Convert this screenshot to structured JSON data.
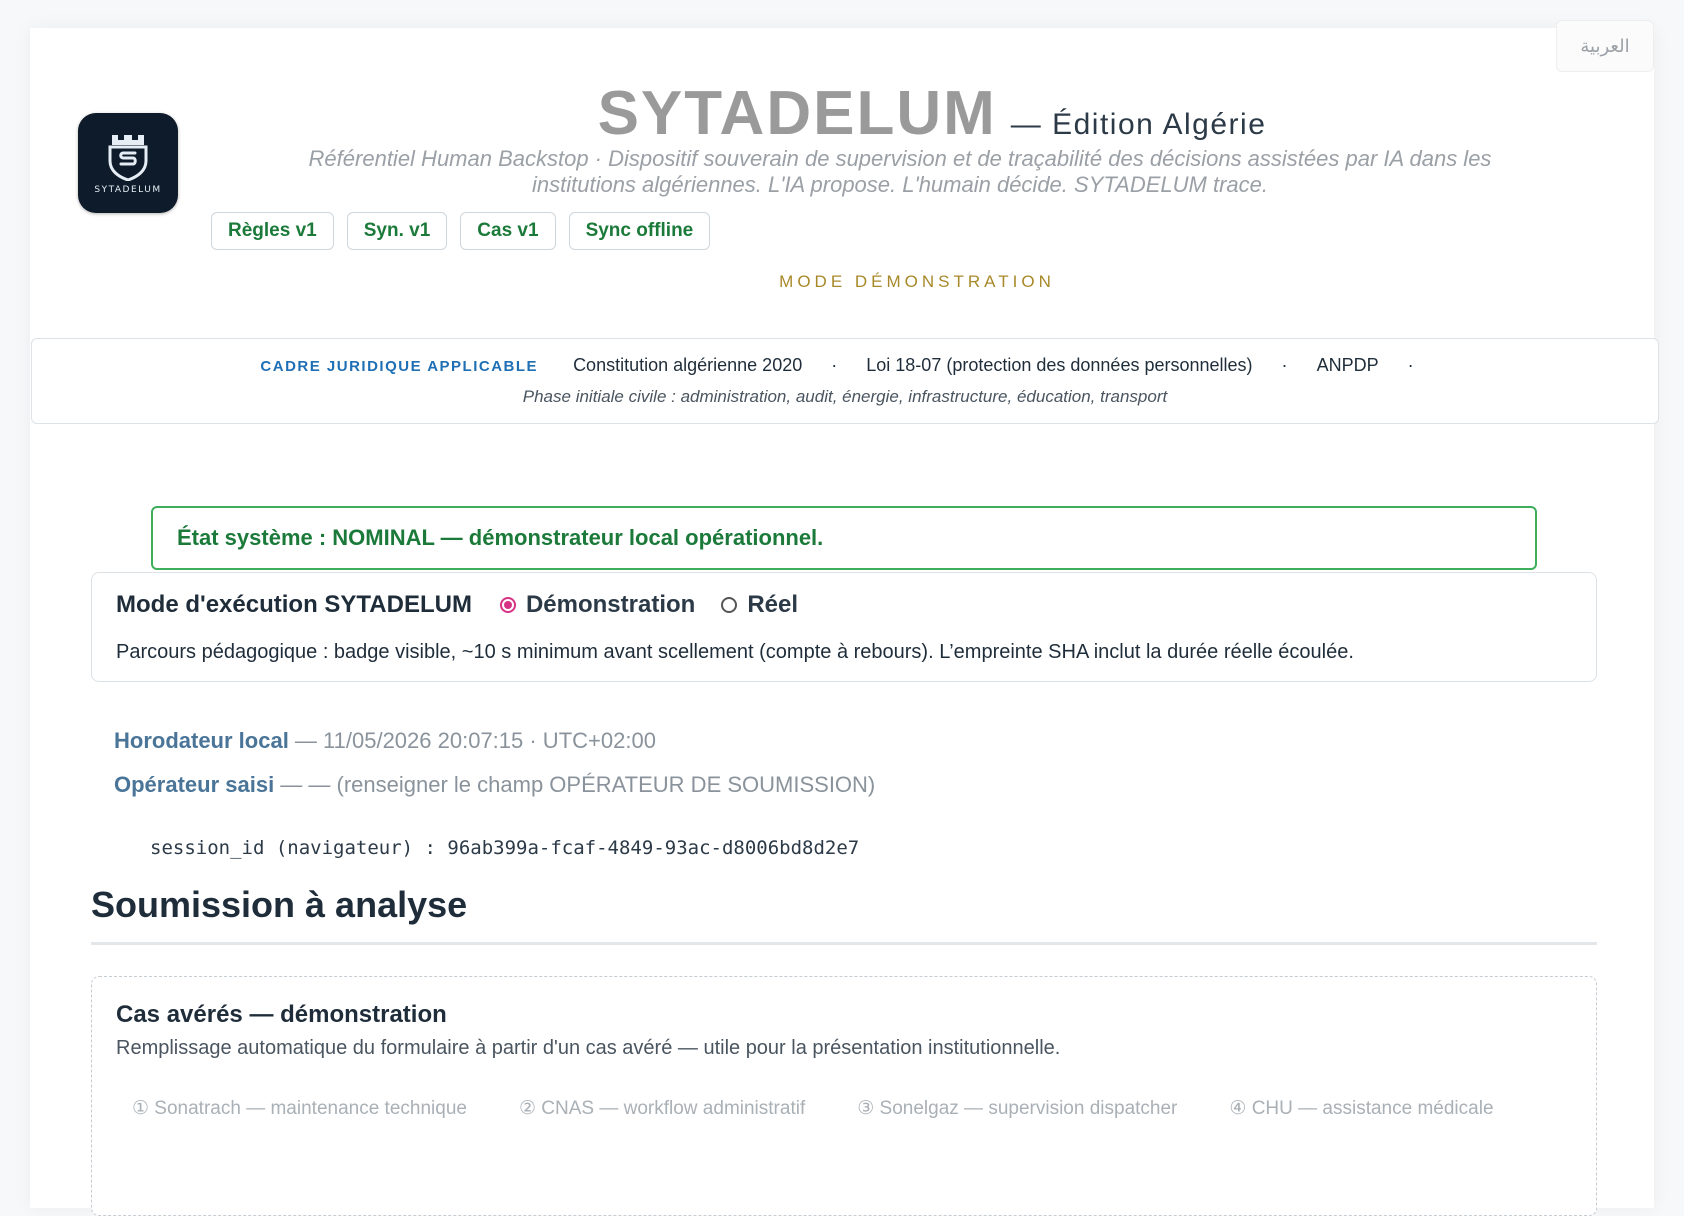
{
  "lang_switch": "العربية",
  "header": {
    "logo_text": "SYTADELUM",
    "brand": "SYTADELUM",
    "edition": "— Édition Algérie",
    "subtitle_line1": "Référentiel Human Backstop · Dispositif souverain de supervision et de traçabilité des décisions assistées par IA dans les",
    "subtitle_line2": "institutions algériennes. L'IA propose. L'humain décide. SYTADELUM trace.",
    "badges": [
      "Règles v1",
      "Syn. v1",
      "Cas v1",
      "Sync offline"
    ],
    "mode": "MODE DÉMONSTRATION"
  },
  "legal": {
    "label": "CADRE JURIDIQUE APPLICABLE",
    "items": [
      "Constitution algérienne 2020",
      "Loi 18-07 (protection des données personnelles)",
      "ANPDP"
    ],
    "separator": "·",
    "phase": "Phase initiale civile : administration, audit, énergie, infrastructure, éducation, transport"
  },
  "status": {
    "text": "État système : NOMINAL — démonstrateur local opérationnel.",
    "color": "#3fae5a"
  },
  "execution": {
    "title": "Mode d'exécution SYTADELUM",
    "options": [
      {
        "label": "Démonstration",
        "selected": true
      },
      {
        "label": "Réel",
        "selected": false
      }
    ],
    "description": "Parcours pédagogique : badge visible, ~10 s minimum avant scellement (compte à rebours). L’empreinte SHA inclut la durée réelle écoulée."
  },
  "meta": {
    "timestamp_label": "Horodateur local",
    "timestamp_value": " — 11/05/2026 20:07:15 · UTC+02:00",
    "operator_label": "Opérateur saisi",
    "operator_value": " — — (renseigner le champ OPÉRATEUR DE SOUMISSION)",
    "session": "session_id (navigateur) : 96ab399a-fcaf-4849-93ac-d8006bd8d2e7"
  },
  "submission": {
    "title": "Soumission à analyse",
    "cases_title": "Cas avérés — démonstration",
    "cases_desc": "Remplissage automatique du formulaire à partir d'un cas avéré — utile pour la présentation institutionnelle.",
    "cases": [
      "① Sonatrach — maintenance technique",
      "② CNAS — workflow administratif",
      "③ Sonelgaz — supervision dispatcher",
      "④ CHU — assistance médicale"
    ]
  },
  "colors": {
    "badge_green": "#1b7a3a",
    "mode_gold": "#a8892a",
    "legal_blue": "#1f6fb5",
    "radio_pink": "#d63384"
  }
}
